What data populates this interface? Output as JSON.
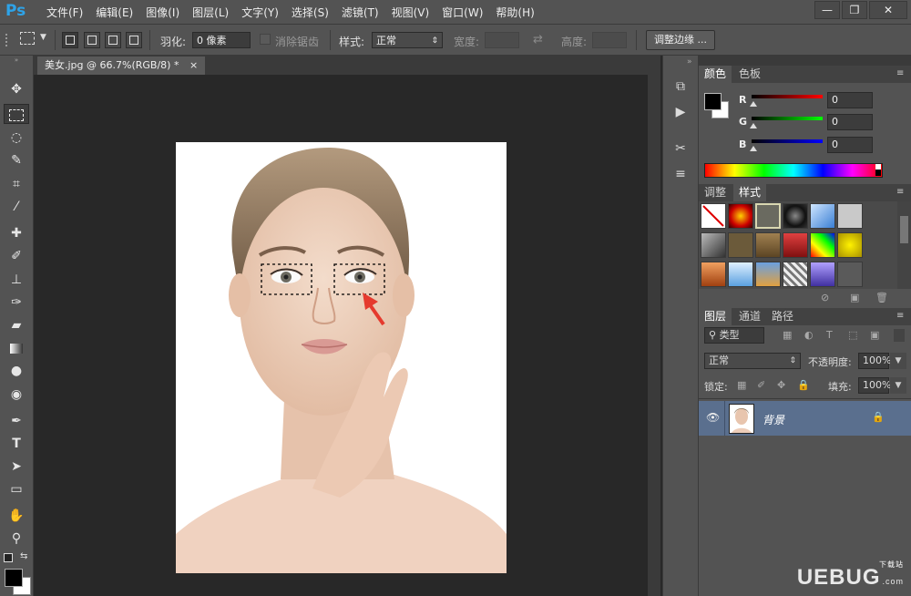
{
  "app": {
    "logo": "Ps"
  },
  "menu": [
    "文件(F)",
    "编辑(E)",
    "图像(I)",
    "图层(L)",
    "文字(Y)",
    "选择(S)",
    "滤镜(T)",
    "视图(V)",
    "窗口(W)",
    "帮助(H)"
  ],
  "window_controls": {
    "minimize": "—",
    "restore": "❐",
    "close": "✕"
  },
  "options": {
    "feather_label": "羽化:",
    "feather_value": "0 像素",
    "antialias_label": "消除锯齿",
    "style_label": "样式:",
    "style_value": "正常",
    "width_label": "宽度:",
    "height_label": "高度:",
    "refine_edge_button": "调整边缘 ..."
  },
  "document": {
    "tab_title": "美女.jpg @ 66.7%(RGB/8) *",
    "tab_close": "×"
  },
  "panels": {
    "color_tabs": [
      "颜色",
      "色板"
    ],
    "channels": [
      {
        "label": "R",
        "value": "0"
      },
      {
        "label": "G",
        "value": "0"
      },
      {
        "label": "B",
        "value": "0"
      }
    ],
    "style_tabs": [
      "调整",
      "样式"
    ],
    "layers_tabs": [
      "图层",
      "通道",
      "路径"
    ],
    "filter_kind": "类型",
    "blend_mode": "正常",
    "opacity_label": "不透明度:",
    "opacity_value": "100%",
    "lock_label": "锁定:",
    "fill_label": "填充:",
    "fill_value": "100%",
    "layer_name": "背景"
  },
  "watermark": {
    "text": "UEBUG",
    "suffix": ".com",
    "sub": "下载站"
  },
  "colors": {
    "accent_blue": "#2ea3e8",
    "selected_layer": "#5a6f8e"
  }
}
